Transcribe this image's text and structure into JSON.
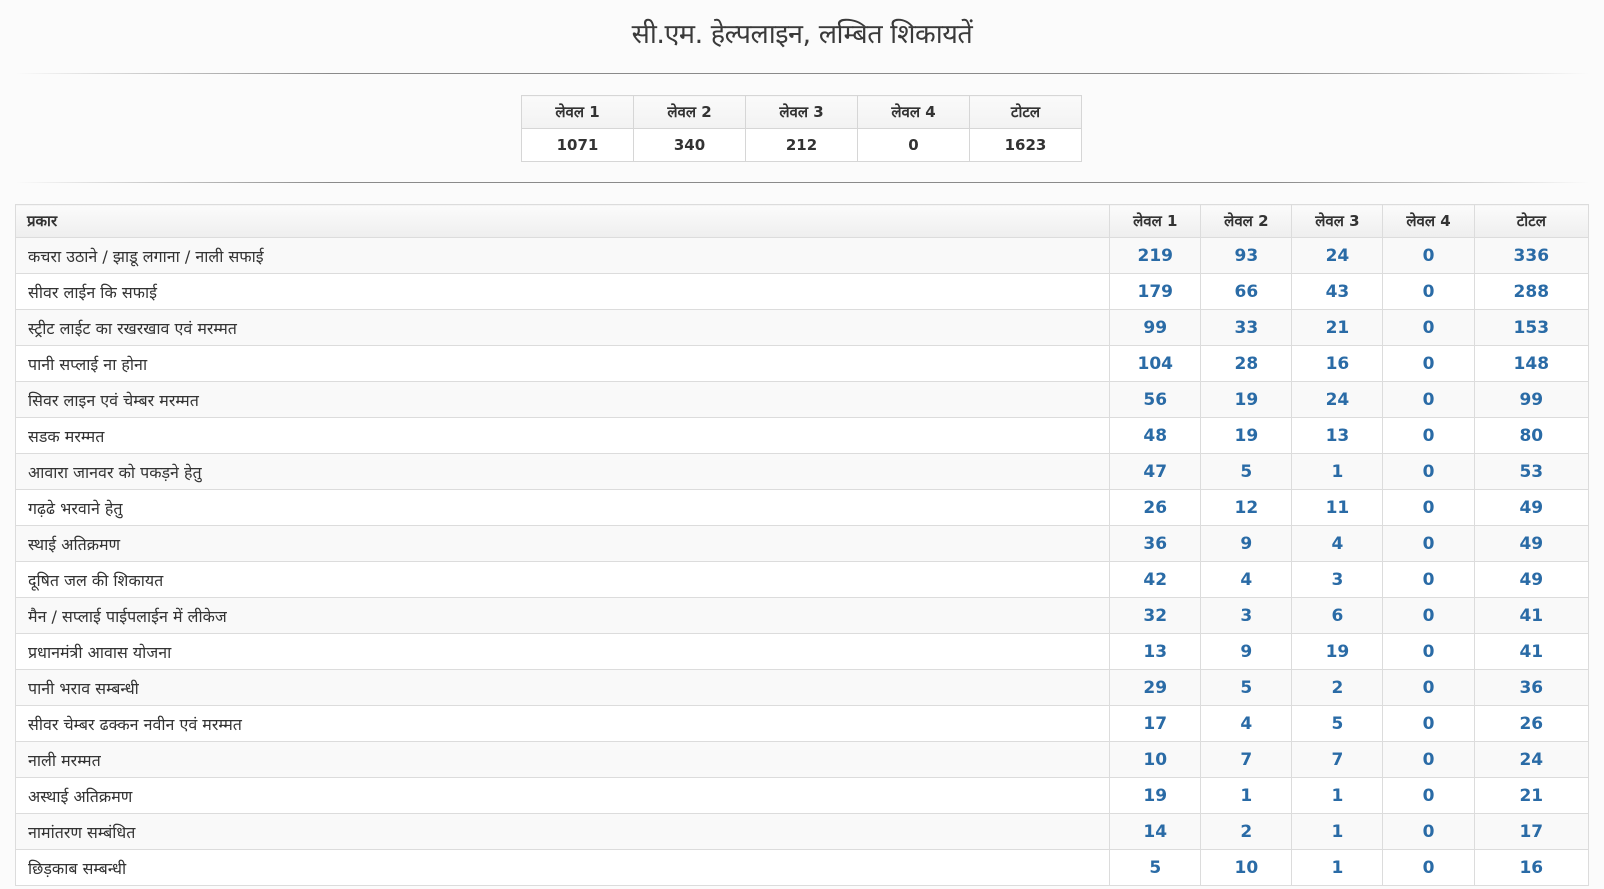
{
  "page_title": "सी.एम. हेल्पलाइन, लम्बित शिकायतें",
  "summary": {
    "headers": [
      "लेवल 1",
      "लेवल 2",
      "लेवल 3",
      "लेवल 4",
      "टोटल"
    ],
    "values": [
      "1071",
      "340",
      "212",
      "0",
      "1623"
    ]
  },
  "table": {
    "headers": [
      "प्रकार",
      "लेवल 1",
      "लेवल 2",
      "लेवल 3",
      "लेवल 4",
      "टोटल"
    ],
    "rows": [
      [
        "कचरा उठाने / झाडू लगाना / नाली सफाई",
        "219",
        "93",
        "24",
        "0",
        "336"
      ],
      [
        "सीवर लाईन कि सफाई",
        "179",
        "66",
        "43",
        "0",
        "288"
      ],
      [
        "स्ट्रीट लाईट का रखरखाव एवं मरम्मत",
        "99",
        "33",
        "21",
        "0",
        "153"
      ],
      [
        "पानी सप्लाई ना होना",
        "104",
        "28",
        "16",
        "0",
        "148"
      ],
      [
        "सिवर लाइन एवं चेम्बर मरम्मत",
        "56",
        "19",
        "24",
        "0",
        "99"
      ],
      [
        "सडक मरम्मत",
        "48",
        "19",
        "13",
        "0",
        "80"
      ],
      [
        "आवारा जानवर को पकड़ने हेतु",
        "47",
        "5",
        "1",
        "0",
        "53"
      ],
      [
        "गढ़ढे भरवाने हेतु",
        "26",
        "12",
        "11",
        "0",
        "49"
      ],
      [
        "स्थाई अतिक्रमण",
        "36",
        "9",
        "4",
        "0",
        "49"
      ],
      [
        "दूषित जल की शिकायत",
        "42",
        "4",
        "3",
        "0",
        "49"
      ],
      [
        "मैन / सप्लाई पाईपलाईन में लीकेज",
        "32",
        "3",
        "6",
        "0",
        "41"
      ],
      [
        "प्रधानमंत्री आवास योजना",
        "13",
        "9",
        "19",
        "0",
        "41"
      ],
      [
        "पानी भराव सम्बन्धी",
        "29",
        "5",
        "2",
        "0",
        "36"
      ],
      [
        "सीवर चेम्बर ढक्कन नवीन एवं मरम्मत",
        "17",
        "4",
        "5",
        "0",
        "26"
      ],
      [
        "नाली मरम्मत",
        "10",
        "7",
        "7",
        "0",
        "24"
      ],
      [
        "अस्थाई अतिक्रमण",
        "19",
        "1",
        "1",
        "0",
        "21"
      ],
      [
        "नामांतरण सम्बंधित",
        "14",
        "2",
        "1",
        "0",
        "17"
      ],
      [
        "छिड़काब सम्बन्धी",
        "5",
        "10",
        "1",
        "0",
        "16"
      ]
    ]
  }
}
